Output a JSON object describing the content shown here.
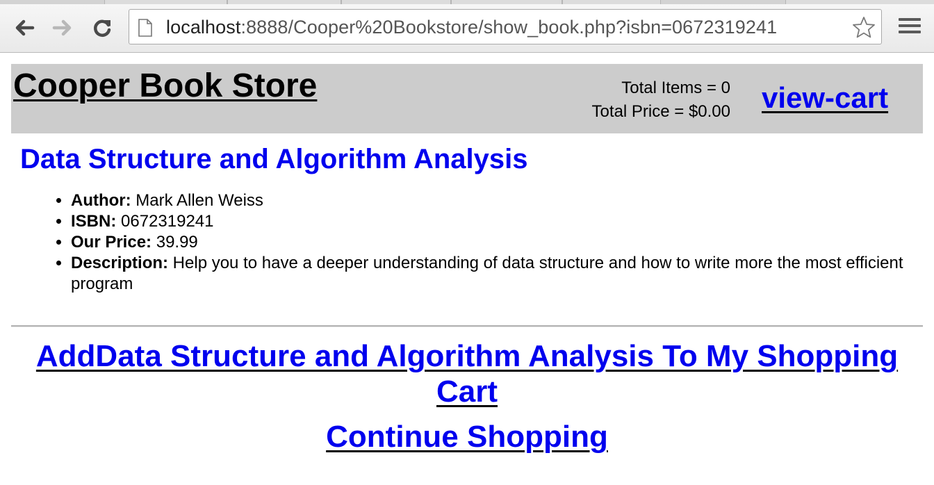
{
  "browser": {
    "url_host": "localhost",
    "url_rest": ":8888/Cooper%20Bookstore/show_book.php?isbn=0672319241",
    "icons": {
      "back": "back-arrow-icon",
      "forward": "forward-arrow-icon",
      "reload": "reload-icon",
      "page": "page-icon",
      "bookmark": "star-icon",
      "menu": "hamburger-menu-icon"
    }
  },
  "header": {
    "store_name": "Cooper Book Store",
    "total_items": "Total Items = 0",
    "total_price": "Total Price = $0.00",
    "view_cart": "view-cart"
  },
  "book": {
    "title": "Data Structure and Algorithm Analysis",
    "details": [
      {
        "label": "Author:",
        "value": " Mark Allen Weiss"
      },
      {
        "label": "ISBN:",
        "value": " 0672319241"
      },
      {
        "label": "Our Price:",
        "value": " 39.99"
      },
      {
        "label": "Description:",
        "value": " Help you to have a deeper understanding of data structure and how to write more the most efficient program"
      }
    ]
  },
  "actions": {
    "add_to_cart": "AddData Structure and Algorithm Analysis To My Shopping Cart",
    "continue_shopping": "Continue Shopping"
  },
  "colors": {
    "link": "#0000ee",
    "header_bg": "#cccccc"
  }
}
